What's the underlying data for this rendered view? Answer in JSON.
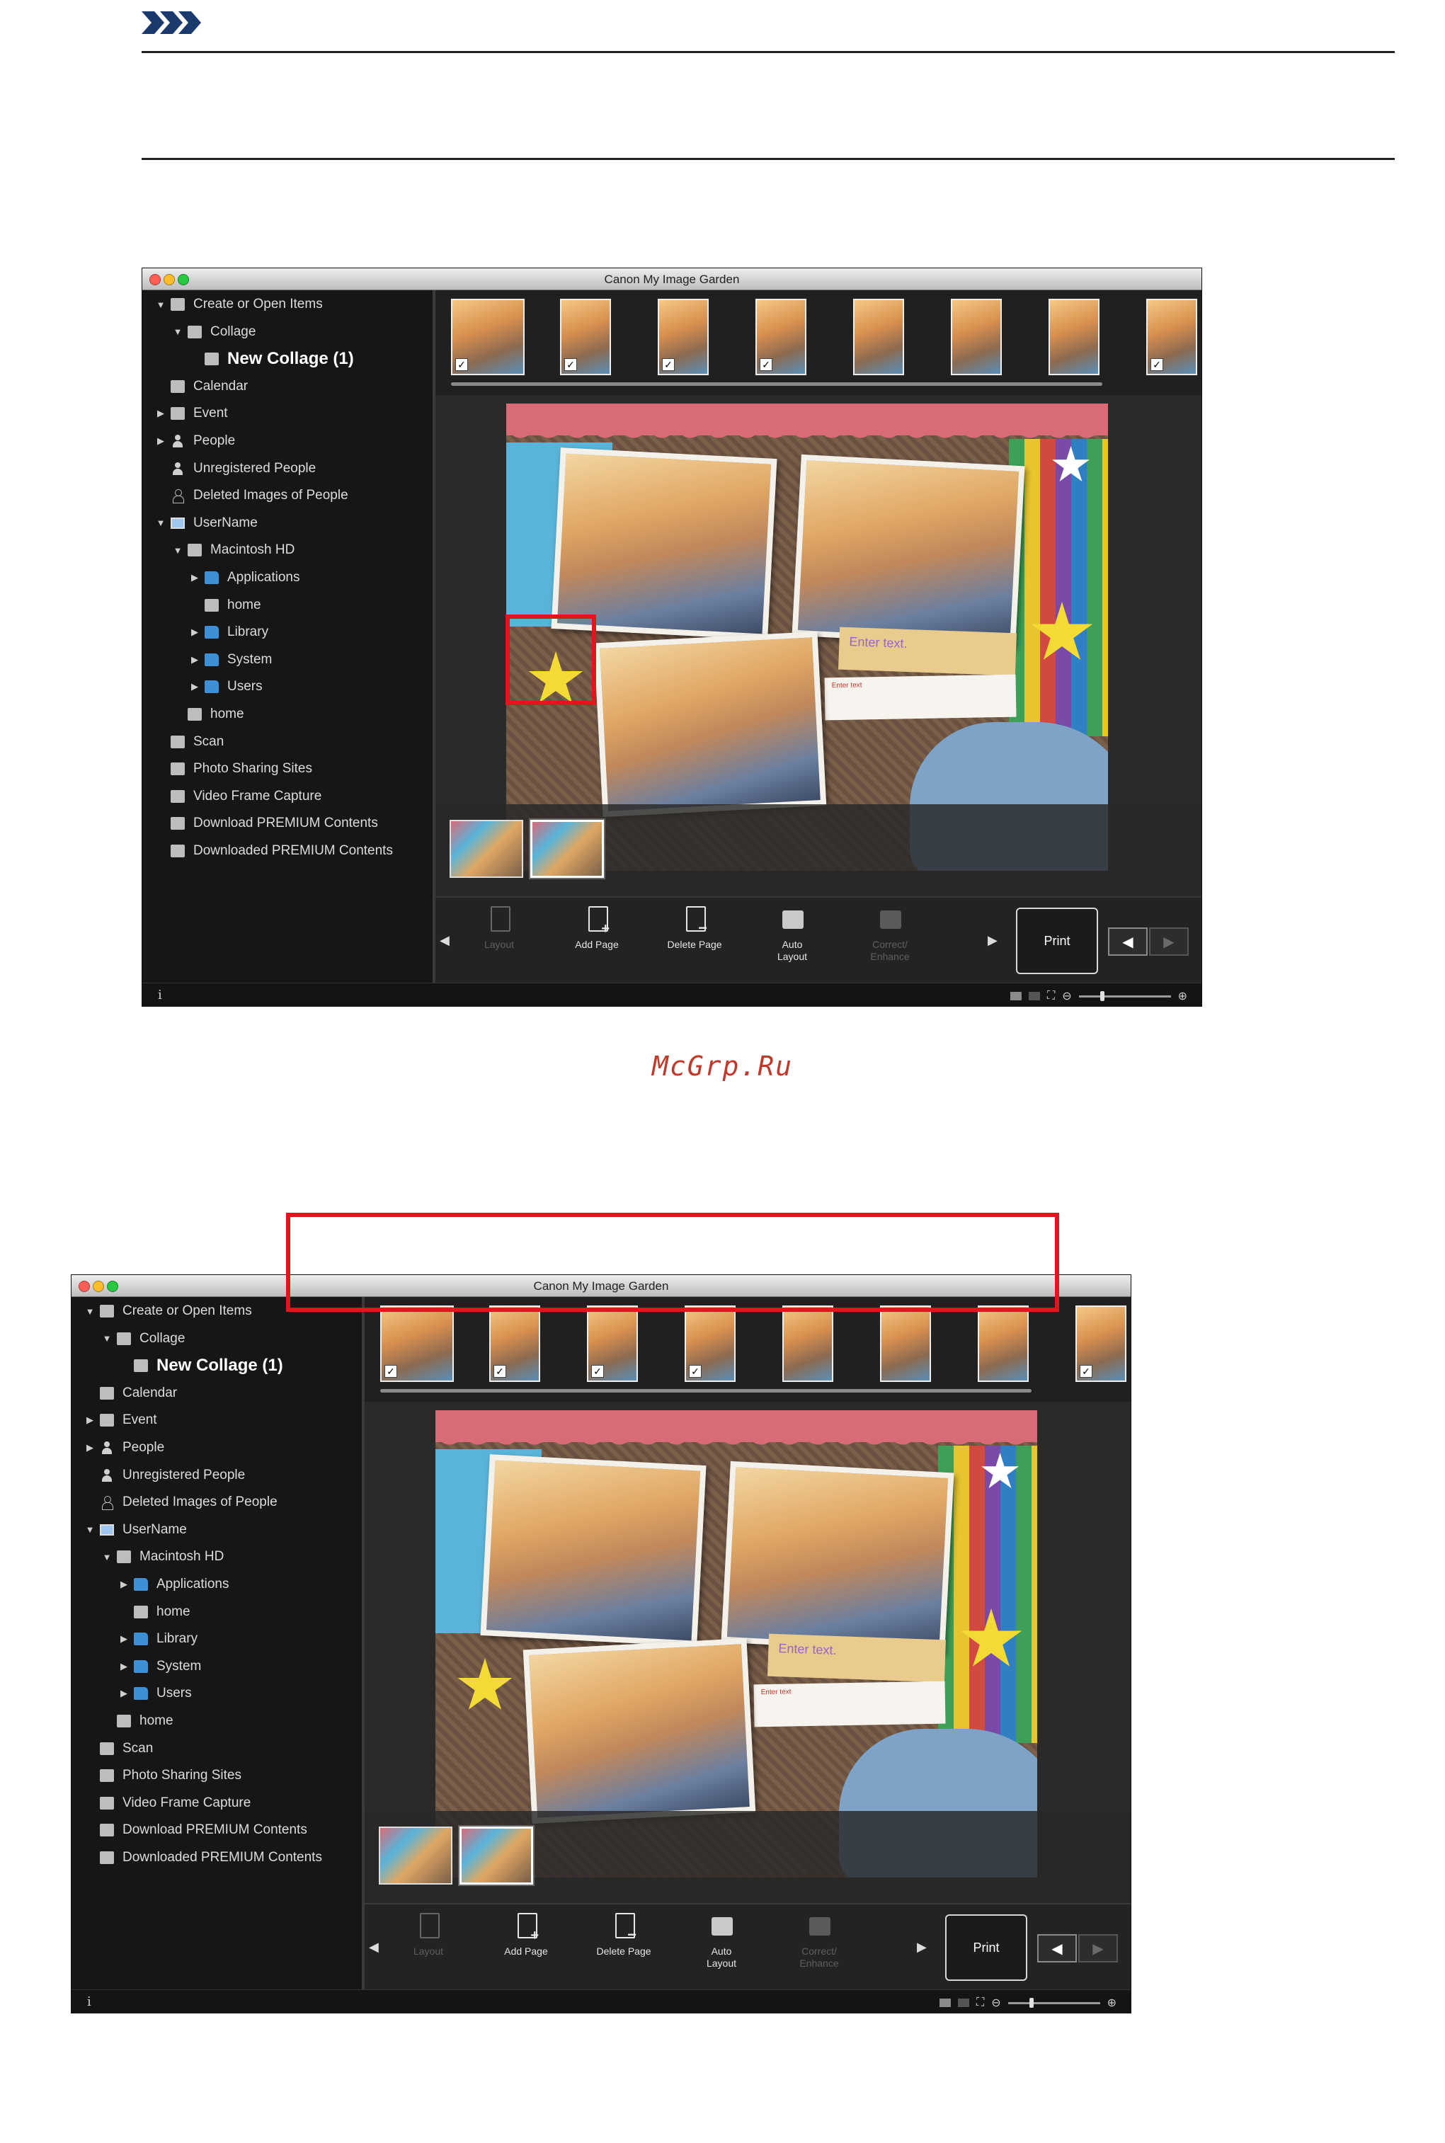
{
  "watermark": "McGrp.Ru",
  "screens": [
    {
      "title": "Canon My Image Garden",
      "highlight": "delete-page-button",
      "sidebar": {
        "items": [
          {
            "label": "Create or Open Items",
            "level": 0,
            "arrow": "open",
            "icon": "create-icon"
          },
          {
            "label": "Collage",
            "level": 1,
            "arrow": "open",
            "icon": "collage-icon"
          },
          {
            "label": "New Collage (1)",
            "level": 2,
            "arrow": "none",
            "icon": "collage-item-icon",
            "selected": true
          },
          {
            "label": "Calendar",
            "level": 0,
            "arrow": "none",
            "icon": "calendar-icon"
          },
          {
            "label": "Event",
            "level": 0,
            "arrow": "closed",
            "icon": "event-icon"
          },
          {
            "label": "People",
            "level": 0,
            "arrow": "closed",
            "icon": "people-icon"
          },
          {
            "label": "Unregistered People",
            "level": 0,
            "arrow": "none",
            "icon": "unregistered-people-icon"
          },
          {
            "label": "Deleted Images of People",
            "level": 0,
            "arrow": "none",
            "icon": "deleted-people-icon"
          },
          {
            "label": "UserName",
            "level": 0,
            "arrow": "open",
            "icon": "computer-icon"
          },
          {
            "label": "Macintosh HD",
            "level": 1,
            "arrow": "open",
            "icon": "hard-drive-icon"
          },
          {
            "label": "Applications",
            "level": 2,
            "arrow": "closed",
            "icon": "folder-icon"
          },
          {
            "label": "home",
            "level": 2,
            "arrow": "none",
            "icon": "home-icon"
          },
          {
            "label": "Library",
            "level": 2,
            "arrow": "closed",
            "icon": "folder-icon"
          },
          {
            "label": "System",
            "level": 2,
            "arrow": "closed",
            "icon": "folder-icon"
          },
          {
            "label": "Users",
            "level": 2,
            "arrow": "closed",
            "icon": "folder-icon"
          },
          {
            "label": "home",
            "level": 1,
            "arrow": "none",
            "icon": "home-icon"
          },
          {
            "label": "Scan",
            "level": 0,
            "arrow": "none",
            "icon": "scan-icon"
          },
          {
            "label": "Photo Sharing Sites",
            "level": 0,
            "arrow": "none",
            "icon": "photo-sharing-icon"
          },
          {
            "label": "Video Frame Capture",
            "level": 0,
            "arrow": "none",
            "icon": "video-capture-icon"
          },
          {
            "label": "Download PREMIUM Contents",
            "level": 0,
            "arrow": "none",
            "icon": "download-icon"
          },
          {
            "label": "Downloaded PREMIUM Contents",
            "level": 0,
            "arrow": "none",
            "icon": "downloaded-folder-icon"
          }
        ]
      },
      "filmstrip_count": 8,
      "text_placeholder_large": "Enter text.",
      "text_placeholder_small": "Enter text",
      "toolbar": {
        "layout": "Layout",
        "add_page": "Add Page",
        "delete_page": "Delete Page",
        "auto_layout_1": "Auto",
        "auto_layout_2": "Layout",
        "correct_1": "Correct/",
        "correct_2": "Enhance",
        "print": "Print"
      },
      "status": {
        "info_icon": "i"
      }
    },
    {
      "title": "Canon My Image Garden",
      "highlight": "page-thumbnail-area",
      "sidebar": {
        "items": [
          {
            "label": "Create or Open Items",
            "level": 0,
            "arrow": "open",
            "icon": "create-icon"
          },
          {
            "label": "Collage",
            "level": 1,
            "arrow": "open",
            "icon": "collage-icon"
          },
          {
            "label": "New Collage (1)",
            "level": 2,
            "arrow": "none",
            "icon": "collage-item-icon",
            "selected": true
          },
          {
            "label": "Calendar",
            "level": 0,
            "arrow": "none",
            "icon": "calendar-icon"
          },
          {
            "label": "Event",
            "level": 0,
            "arrow": "closed",
            "icon": "event-icon"
          },
          {
            "label": "People",
            "level": 0,
            "arrow": "closed",
            "icon": "people-icon"
          },
          {
            "label": "Unregistered People",
            "level": 0,
            "arrow": "none",
            "icon": "unregistered-people-icon"
          },
          {
            "label": "Deleted Images of People",
            "level": 0,
            "arrow": "none",
            "icon": "deleted-people-icon"
          },
          {
            "label": "UserName",
            "level": 0,
            "arrow": "open",
            "icon": "computer-icon"
          },
          {
            "label": "Macintosh HD",
            "level": 1,
            "arrow": "open",
            "icon": "hard-drive-icon"
          },
          {
            "label": "Applications",
            "level": 2,
            "arrow": "closed",
            "icon": "folder-icon"
          },
          {
            "label": "home",
            "level": 2,
            "arrow": "none",
            "icon": "home-icon"
          },
          {
            "label": "Library",
            "level": 2,
            "arrow": "closed",
            "icon": "folder-icon"
          },
          {
            "label": "System",
            "level": 2,
            "arrow": "closed",
            "icon": "folder-icon"
          },
          {
            "label": "Users",
            "level": 2,
            "arrow": "closed",
            "icon": "folder-icon"
          },
          {
            "label": "home",
            "level": 1,
            "arrow": "none",
            "icon": "home-icon"
          },
          {
            "label": "Scan",
            "level": 0,
            "arrow": "none",
            "icon": "scan-icon"
          },
          {
            "label": "Photo Sharing Sites",
            "level": 0,
            "arrow": "none",
            "icon": "photo-sharing-icon"
          },
          {
            "label": "Video Frame Capture",
            "level": 0,
            "arrow": "none",
            "icon": "video-capture-icon"
          },
          {
            "label": "Download PREMIUM Contents",
            "level": 0,
            "arrow": "none",
            "icon": "download-icon"
          },
          {
            "label": "Downloaded PREMIUM Contents",
            "level": 0,
            "arrow": "none",
            "icon": "downloaded-folder-icon"
          }
        ]
      },
      "filmstrip_count": 8,
      "text_placeholder_large": "Enter text.",
      "text_placeholder_small": "Enter text",
      "toolbar": {
        "layout": "Layout",
        "add_page": "Add Page",
        "delete_page": "Delete Page",
        "auto_layout_1": "Auto",
        "auto_layout_2": "Layout",
        "correct_1": "Correct/",
        "correct_2": "Enhance",
        "print": "Print"
      },
      "status": {
        "info_icon": "i"
      }
    }
  ]
}
